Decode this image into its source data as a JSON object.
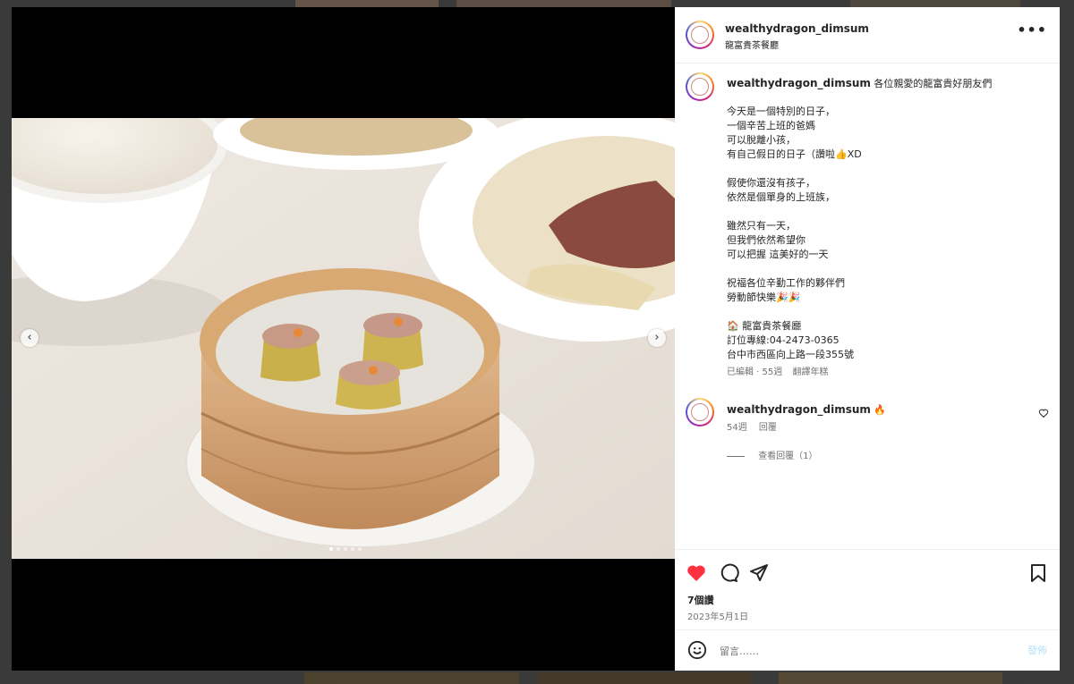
{
  "post": {
    "username": "wealthydragon_dimsum",
    "location": "龍富貴茶餐廳",
    "caption_intro": "各位親愛的龍富貴好朋友們",
    "caption_lines": [
      "今天是一個特別的日子，",
      "一個辛苦上班的爸媽",
      "可以脫離小孩，",
      "有自己假日的日子（讚啦👍XD",
      "",
      "假使你還沒有孩子，",
      "依然是個單身的上班族，",
      "",
      "雖然只有一天，",
      "但我們依然希望你",
      "可以把握 這美好的一天",
      "",
      "祝福各位辛勤工作的夥伴們",
      "勞動節快樂🎉🎉",
      "",
      "🏠 龍富貴茶餐廳",
      "訂位專線:04-2473-0365",
      "台中市西區向上路一段355號"
    ],
    "caption_meta": "已編輯 · 55週",
    "translate_label": "翻譯年糕",
    "reply": {
      "username": "wealthydragon_dimsum",
      "text": "🔥",
      "time": "54週",
      "reply_label": "回覆",
      "view_replies": "查看回覆（1）"
    },
    "likes": "7個讚",
    "date": "2023年5月1日",
    "comment_placeholder": "留言……",
    "post_button": "發佈",
    "more_icon": "•••",
    "prev_icon": "‹",
    "next_icon": "›",
    "colors": {
      "like_red": "#ff3040",
      "post_blue": "#b2dffc"
    }
  }
}
